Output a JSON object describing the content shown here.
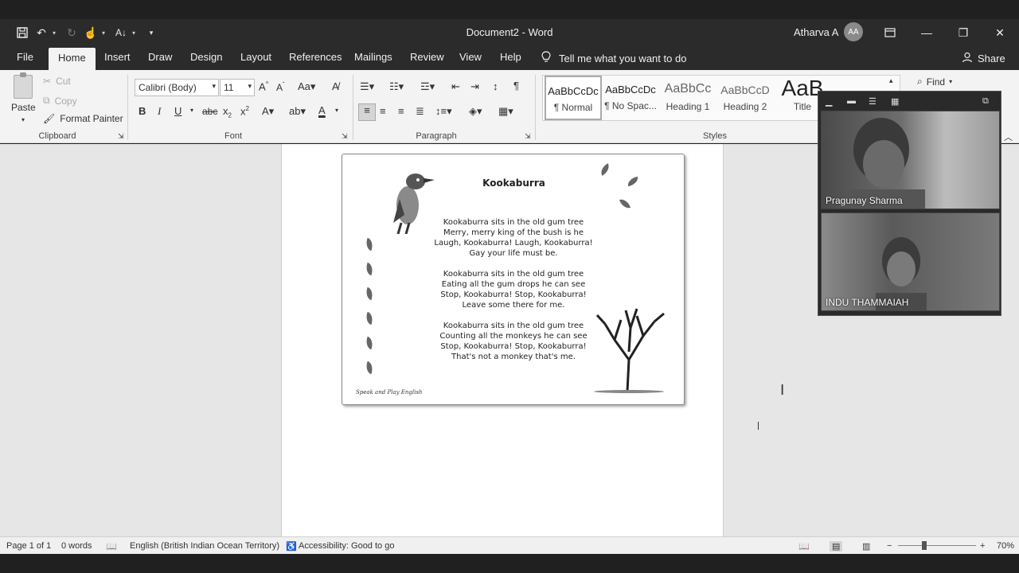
{
  "window": {
    "title": "Document2  -  Word",
    "user_name": "Atharva A",
    "user_initials": "AA"
  },
  "tabs": [
    "File",
    "Home",
    "Insert",
    "Draw",
    "Design",
    "Layout",
    "References",
    "Mailings",
    "Review",
    "View",
    "Help"
  ],
  "tell_me": "Tell me what you want to do",
  "share_label": "Share",
  "ribbon": {
    "clipboard": {
      "paste": "Paste",
      "cut": "Cut",
      "copy": "Copy",
      "format_painter": "Format Painter",
      "group_label": "Clipboard"
    },
    "font": {
      "family": "Calibri (Body)",
      "size": "11",
      "group_label": "Font"
    },
    "paragraph": {
      "group_label": "Paragraph"
    },
    "styles": {
      "group_label": "Styles",
      "items": [
        {
          "sample": "AaBbCcDc",
          "name": "¶ Normal"
        },
        {
          "sample": "AaBbCcDc",
          "name": "¶ No Spac..."
        },
        {
          "sample": "AaBbCc",
          "name": "Heading 1"
        },
        {
          "sample": "AaBbCcD",
          "name": "Heading 2"
        },
        {
          "sample": "AaB",
          "name": "Title"
        }
      ]
    },
    "find_label": "Find"
  },
  "document": {
    "poem_title": "Kookaburra",
    "stanzas": [
      [
        "Kookaburra sits in the old gum tree",
        "Merry, merry king of the bush is he",
        "Laugh, Kookaburra! Laugh, Kookaburra!",
        "Gay your life must be."
      ],
      [
        "Kookaburra sits in the old gum tree",
        "Eating all the gum drops he can see",
        "Stop, Kookaburra! Stop, Kookaburra!",
        "Leave some there for me."
      ],
      [
        "Kookaburra sits in the old gum tree",
        "Counting all the monkeys he can see",
        "Stop, Kookaburra! Stop, Kookaburra!",
        "That's not a monkey that's me."
      ]
    ],
    "credit": "Speak and Play English"
  },
  "video": {
    "participants": [
      "Pragunay Sharma",
      "INDU THAMMAIAH"
    ]
  },
  "status": {
    "page": "Page 1 of 1",
    "words": "0 words",
    "language": "English (British Indian Ocean Territory)",
    "accessibility": "Accessibility: Good to go",
    "zoom": "70%"
  }
}
